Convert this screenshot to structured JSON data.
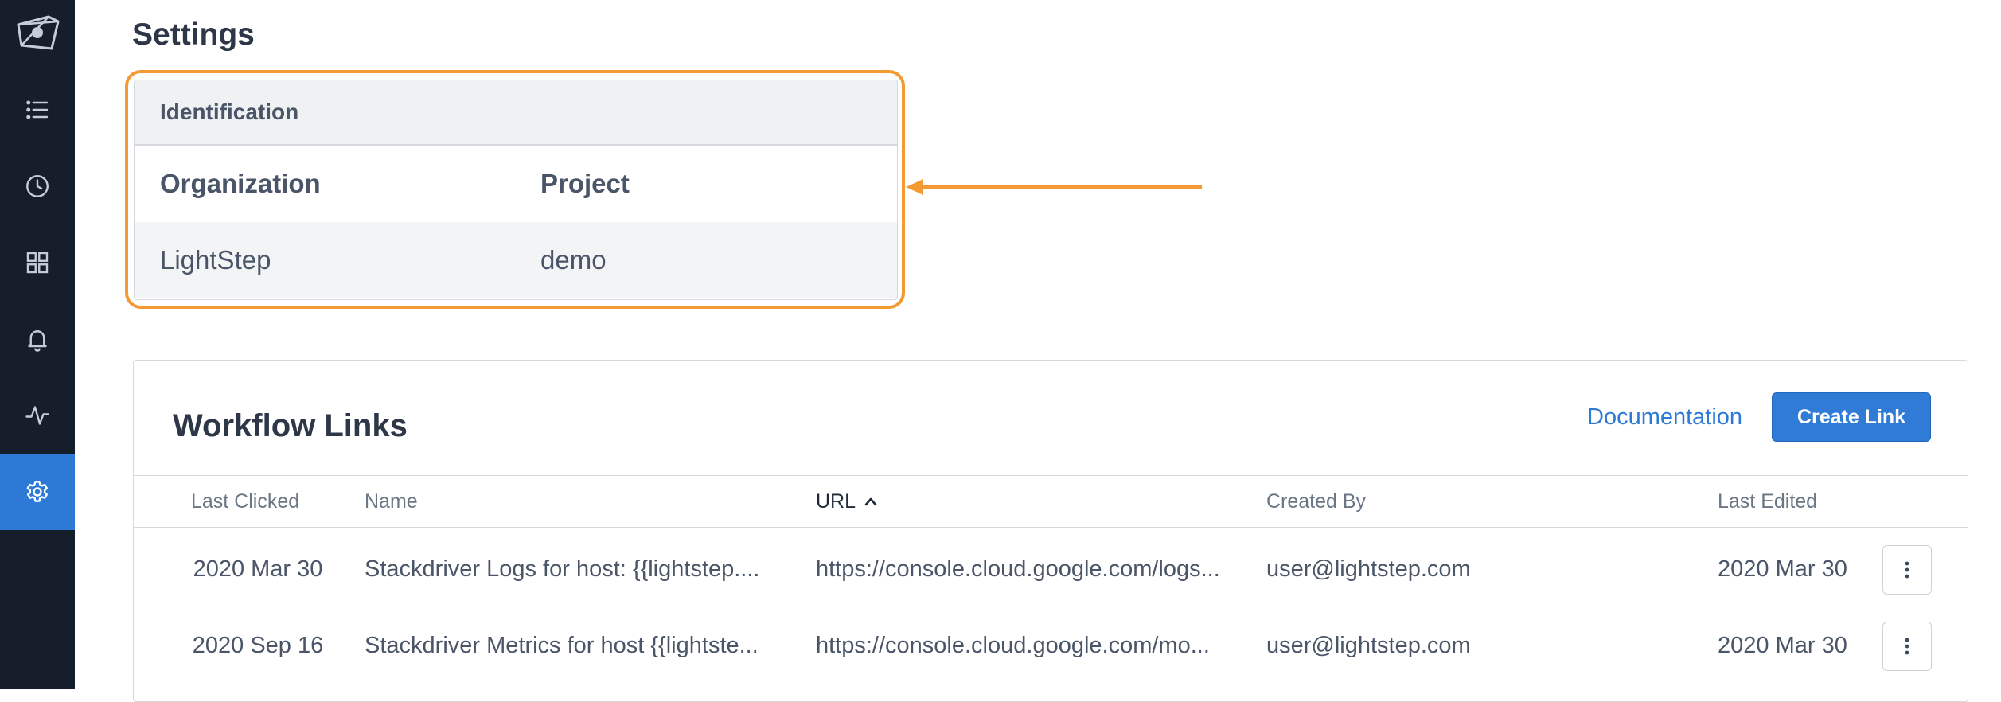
{
  "page": {
    "title": "Settings"
  },
  "sidebar": {
    "items": [
      {
        "icon": "list-icon"
      },
      {
        "icon": "clock-icon"
      },
      {
        "icon": "dashboard-grid-icon"
      },
      {
        "icon": "bell-icon"
      },
      {
        "icon": "activity-icon"
      },
      {
        "icon": "gear-icon",
        "active": true
      }
    ]
  },
  "identification": {
    "header": "Identification",
    "columns": [
      "Organization",
      "Project"
    ],
    "values": [
      "LightStep",
      "demo"
    ]
  },
  "colors": {
    "accent": "#2d7ad6",
    "highlight": "#f39a33",
    "sidebar": "#161d2b"
  },
  "workflow_links": {
    "title": "Workflow Links",
    "documentation_label": "Documentation",
    "create_button_label": "Create Link",
    "columns": [
      "Last Clicked",
      "Name",
      "URL",
      "Created By",
      "Last Edited"
    ],
    "sorted_column": "URL",
    "rows": [
      {
        "last_clicked": "2020 Mar 30",
        "name": "Stackdriver Logs for host: {{lightstep....",
        "url": "https://console.cloud.google.com/logs...",
        "created_by": "user@lightstep.com",
        "last_edited": "2020 Mar 30"
      },
      {
        "last_clicked": "2020 Sep 16",
        "name": "Stackdriver Metrics for host {{lightste...",
        "url": "https://console.cloud.google.com/mo...",
        "created_by": "user@lightstep.com",
        "last_edited": "2020 Mar 30"
      }
    ]
  }
}
